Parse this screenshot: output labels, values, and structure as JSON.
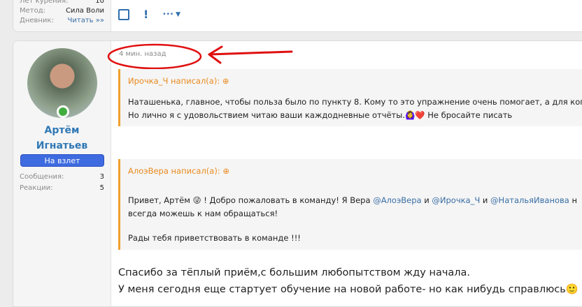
{
  "top_card": {
    "stats": [
      {
        "label": "Лет курения:",
        "value": "10"
      },
      {
        "label": "Метод:",
        "value": "Сила Воли"
      },
      {
        "label": "Дневник:",
        "value": "Читать »»"
      }
    ],
    "actions": {
      "select": "☐",
      "report": "!",
      "more": "•••"
    }
  },
  "post": {
    "author": {
      "name_line1": "Артём",
      "name_line2": "Игнатьев",
      "badge": "На взлет",
      "stats": [
        {
          "label": "Сообщения:",
          "value": "3"
        },
        {
          "label": "Реакции:",
          "value": "5"
        }
      ]
    },
    "time": "4 мин. назад",
    "quotes": [
      {
        "author": "Ирочка_Ч написал(а):",
        "lines": [
          "Наташенька, главное, чтобы польза было по пункту 8. Кому то это упражнение очень помогает, а для кого то",
          "Но лично я с удовольствием читаю ваши каждодневные отчёты.🙆‍♀️❤️ Не бросайте писать"
        ]
      },
      {
        "author": "АлоэВера написал(а):",
        "greeting": "Привет, Артём",
        "emoji": "😜",
        "text1": "! Добро пожаловать в команду! Я Вера",
        "m1": "@АлоэВера",
        "and1": "и",
        "m2": "@Ирочка_Ч",
        "and2": "и",
        "m3": "@НатальяИванова",
        "tail": "н",
        "line2": "всегда можешь к нам обращаться!",
        "line3": "Рады тебя приветствовать в команде !!!"
      }
    ],
    "body": [
      "Спасибо за тёплый приём,с большим любопытством жду начала.",
      "У меня сегодня еще стартует обучение на новой работе- но как нибудь справлюсь🙂"
    ]
  }
}
